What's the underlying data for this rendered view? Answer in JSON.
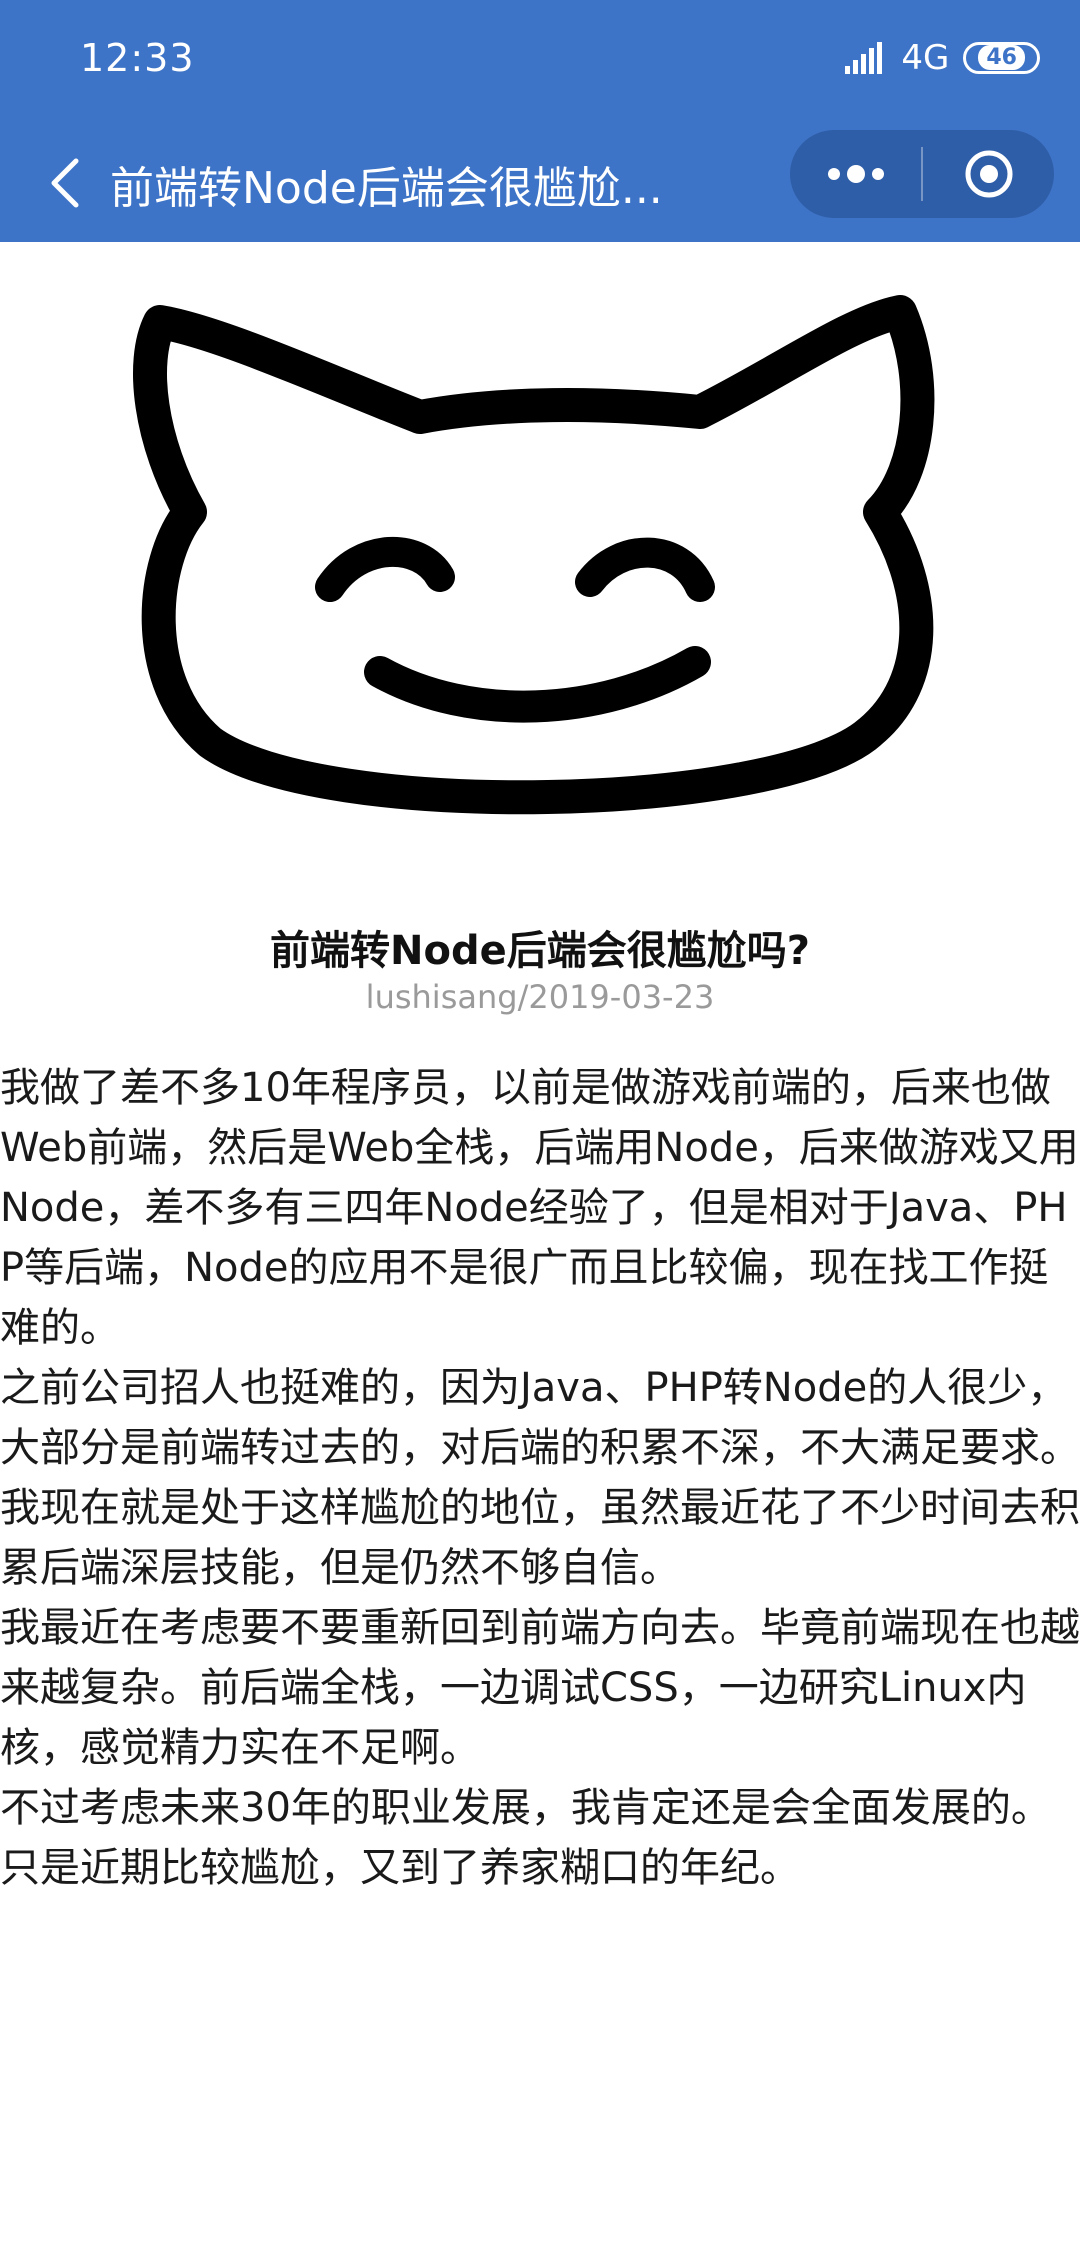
{
  "status_bar": {
    "time": "12:33",
    "network": "4G",
    "battery": "46"
  },
  "nav": {
    "title": "前端转Node后端会很尴尬...",
    "back_icon": "chevron-left-icon",
    "more_icon": "more-dots-icon",
    "close_icon": "target-circle-icon",
    "bar_color": "#3e74c7"
  },
  "post": {
    "cover_icon": "smiling-cat-face",
    "title": "前端转Node后端会很尴尬吗?",
    "meta": "lushisang/2019-03-23",
    "paragraphs": [
      "我做了差不多10年程序员，以前是做游戏前端的，后来也做Web前端，然后是Web全栈，后端用Node，后来做游戏又用Node，差不多有三四年Node经验了，但是相对于Java、PHP等后端，Node的应用不是很广而且比较偏，现在找工作挺难的。",
      "之前公司招人也挺难的，因为Java、PHP转Node的人很少，大部分是前端转过去的，对后端的积累不深，不大满足要求。",
      "我现在就是处于这样尴尬的地位，虽然最近花了不少时间去积累后端深层技能，但是仍然不够自信。",
      "我最近在考虑要不要重新回到前端方向去。毕竟前端现在也越来越复杂。前后端全栈，一边调试CSS，一边研究Linux内核，感觉精力实在不足啊。",
      "不过考虑未来30年的职业发展，我肯定还是会全面发展的。只是近期比较尴尬，又到了养家糊口的年纪。"
    ]
  }
}
